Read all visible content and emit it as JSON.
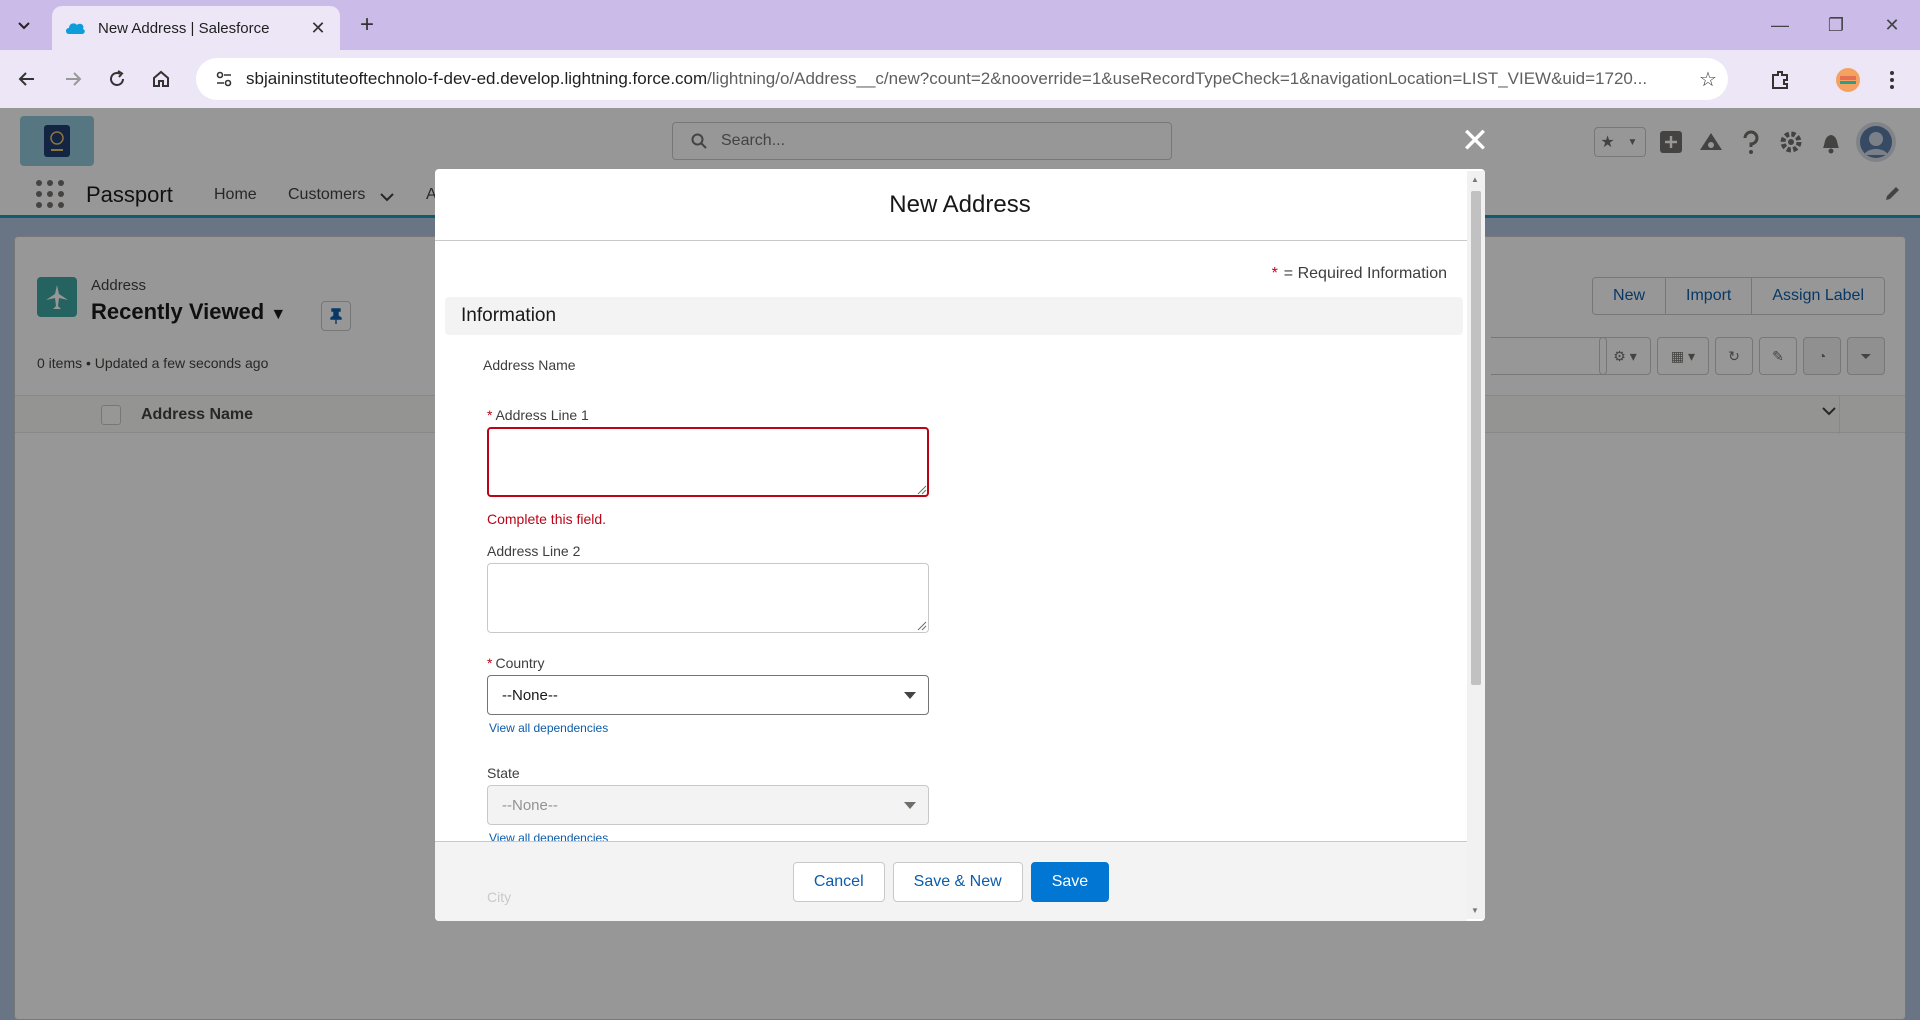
{
  "browser": {
    "tab_title": "New Address | Salesforce",
    "url_host": "sbjaininstituteoftechnolo-f-dev-ed.develop.lightning.force.com",
    "url_path": "/lightning/o/Address__c/new?count=2&nooverride=1&useRecordTypeCheck=1&navigationLocation=LIST_VIEW&uid=1720..."
  },
  "sf": {
    "search_placeholder": "Search...",
    "app_name": "Passport",
    "nav": [
      "Home",
      "Customers",
      "A"
    ],
    "object_label": "Address",
    "list_view_name": "Recently Viewed",
    "list_meta": "0 items • Updated a few seconds ago",
    "buttons": [
      "New",
      "Import",
      "Assign Label"
    ],
    "column_header": "Address Name"
  },
  "modal": {
    "title": "New Address",
    "required_info": "= Required Information",
    "section": "Information",
    "address_name_label": "Address Name",
    "address_line1_label": "Address Line 1",
    "address_line1_value": "",
    "address_line1_error": "Complete this field.",
    "address_line2_label": "Address Line 2",
    "address_line2_value": "",
    "country_label": "Country",
    "country_value": "--None--",
    "view_dependencies": "View all dependencies",
    "state_label": "State",
    "state_value": "--None--",
    "city_label": "City",
    "cancel": "Cancel",
    "save_new": "Save & New",
    "save": "Save"
  },
  "colors": {
    "brand_blue": "#0176d3",
    "error_red": "#ba0517",
    "chrome_purple": "#cbbbe8",
    "object_teal": "#3ba5a0"
  }
}
